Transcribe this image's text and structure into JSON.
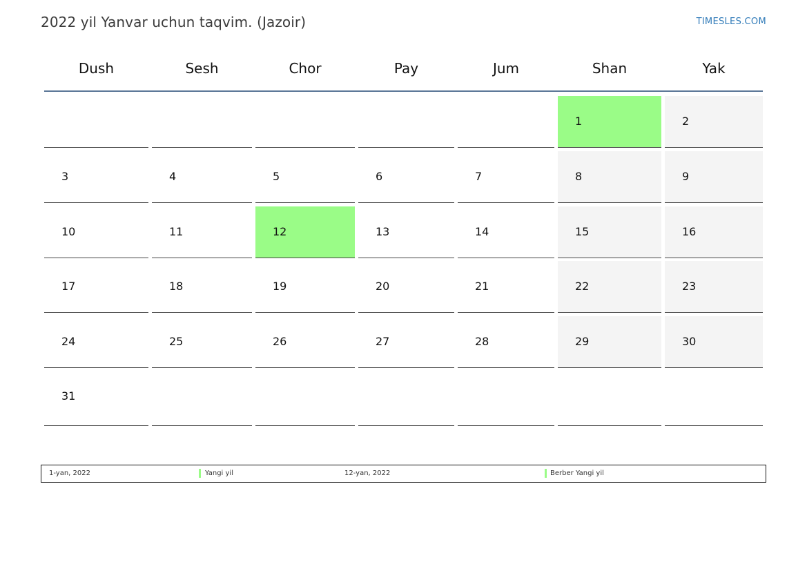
{
  "header": {
    "title": "2022 yil Yanvar uchun taqvim. (Jazoir)",
    "brand": "TIMESLES.COM"
  },
  "calendar": {
    "weekdays": [
      "Dush",
      "Sesh",
      "Chor",
      "Pay",
      "Jum",
      "Shan",
      "Yak"
    ],
    "weeks": [
      [
        "",
        "",
        "",
        "",
        "",
        "1",
        "2"
      ],
      [
        "3",
        "4",
        "5",
        "6",
        "7",
        "8",
        "9"
      ],
      [
        "10",
        "11",
        "12",
        "13",
        "14",
        "15",
        "16"
      ],
      [
        "17",
        "18",
        "19",
        "20",
        "21",
        "22",
        "23"
      ],
      [
        "24",
        "25",
        "26",
        "27",
        "28",
        "29",
        "30"
      ],
      [
        "31",
        "",
        "",
        "",
        "",
        "",
        ""
      ]
    ],
    "holiday_days": [
      "1",
      "12"
    ],
    "colors": {
      "holiday": "#9afc87",
      "weekend": "#f4f4f4",
      "header_rule": "#5a7697",
      "brand": "#2f7ab8"
    }
  },
  "legend": [
    {
      "date": "1-yan, 2022",
      "name": "Yangi yil"
    },
    {
      "date": "12-yan, 2022",
      "name": "Berber Yangi yil"
    }
  ]
}
